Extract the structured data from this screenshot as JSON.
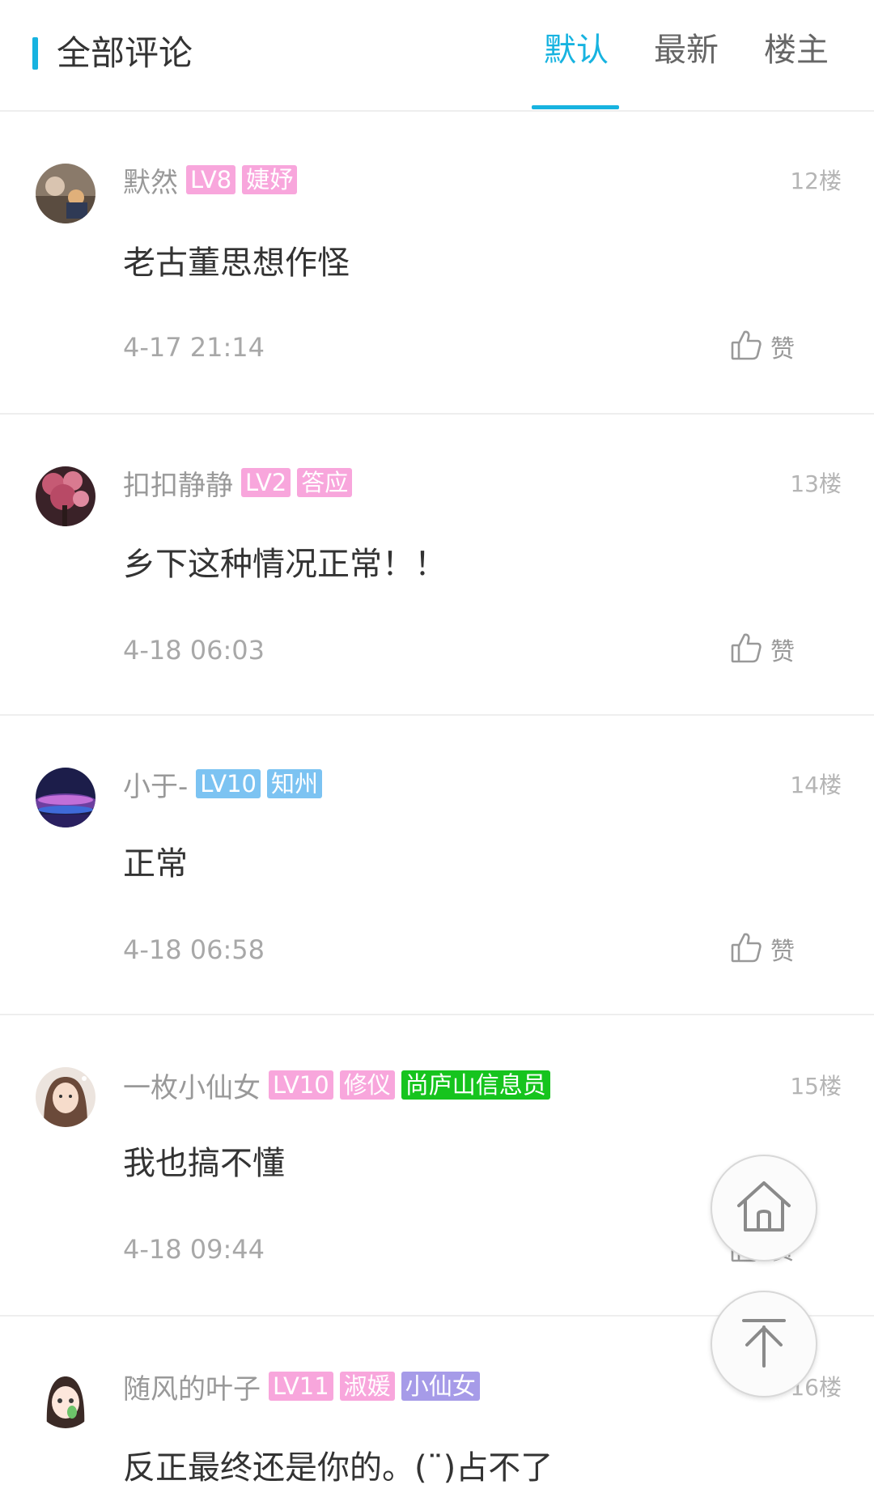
{
  "header": {
    "title": "全部评论",
    "tabs": [
      {
        "label": "默认",
        "active": true
      },
      {
        "label": "最新",
        "active": false
      },
      {
        "label": "楼主",
        "active": false
      }
    ]
  },
  "colors": {
    "accent": "#17b3e0",
    "badge_pink": "#f8a6dc",
    "badge_blue": "#7cc3f2",
    "badge_green": "#16c41e",
    "badge_purple": "#a69be8"
  },
  "like_label": "赞",
  "comments": [
    {
      "username": "默然",
      "badges": [
        "LV8",
        "婕妤"
      ],
      "floor": "12楼",
      "content": "老古董思想作怪",
      "time": "4-17 21:14"
    },
    {
      "username": "扣扣静静",
      "badges": [
        "LV2",
        "答应"
      ],
      "floor": "13楼",
      "content": "乡下这种情况正常！！",
      "time": "4-18 06:03"
    },
    {
      "username": "小于-",
      "badges": [
        "LV10",
        "知州"
      ],
      "floor": "14楼",
      "content": "正常",
      "time": "4-18 06:58"
    },
    {
      "username": "一枚小仙女",
      "badges": [
        "LV10",
        "修仪",
        "尚庐山信息员"
      ],
      "floor": "15楼",
      "content": "我也搞不懂",
      "time": "4-18 09:44"
    },
    {
      "username": "随风的叶子",
      "badges": [
        "LV11",
        "淑媛",
        "小仙女"
      ],
      "floor": "16楼",
      "content": "反正最终还是你的。(¨)占不了",
      "time": ""
    }
  ],
  "floating": {
    "home_icon": "home-icon",
    "top_icon": "back-to-top-icon"
  }
}
